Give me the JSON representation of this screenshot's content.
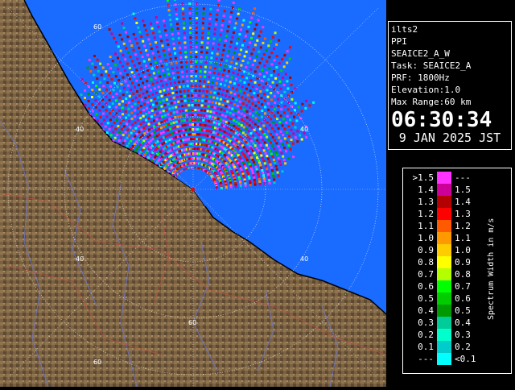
{
  "info": {
    "site": "ilts2",
    "product": "PPI",
    "scan": "SEAICE2_A_W",
    "task": "Task: SEAICE2_A",
    "prf": "PRF: 1800Hz",
    "elevation": "Elevation:1.0",
    "max_range": "Max Range:60 km",
    "time": "06:30:34",
    "date": "9 JAN 2025 JST"
  },
  "legend": {
    "title": "Spectrum Width in m/s",
    "rows": [
      {
        "lo": ">1.5",
        "hi": "---",
        "color": "#ff33ff"
      },
      {
        "lo": "1.4",
        "hi": "1.5",
        "color": "#cc0099"
      },
      {
        "lo": "1.3",
        "hi": "1.4",
        "color": "#b30000"
      },
      {
        "lo": "1.2",
        "hi": "1.3",
        "color": "#ff0000"
      },
      {
        "lo": "1.1",
        "hi": "1.2",
        "color": "#ff5a00"
      },
      {
        "lo": "1.0",
        "hi": "1.1",
        "color": "#ff9900"
      },
      {
        "lo": "0.9",
        "hi": "1.0",
        "color": "#ffcc00"
      },
      {
        "lo": "0.8",
        "hi": "0.9",
        "color": "#ffff00"
      },
      {
        "lo": "0.7",
        "hi": "0.8",
        "color": "#b3ff00"
      },
      {
        "lo": "0.6",
        "hi": "0.7",
        "color": "#00ff00"
      },
      {
        "lo": "0.5",
        "hi": "0.6",
        "color": "#00cc00"
      },
      {
        "lo": "0.4",
        "hi": "0.5",
        "color": "#009900"
      },
      {
        "lo": "0.3",
        "hi": "0.4",
        "color": "#00cc99"
      },
      {
        "lo": "0.2",
        "hi": "0.3",
        "color": "#00ffcc"
      },
      {
        "lo": "0.1",
        "hi": "0.2",
        "color": "#00cccc"
      },
      {
        "lo": "---",
        "hi": "<0.1",
        "color": "#00ffff"
      }
    ]
  },
  "map": {
    "range_labels": [
      "60",
      "60",
      "40",
      "40",
      "40",
      "40",
      "60"
    ],
    "ocean_color": "#1a6bff",
    "land_color": "#7a6040"
  }
}
